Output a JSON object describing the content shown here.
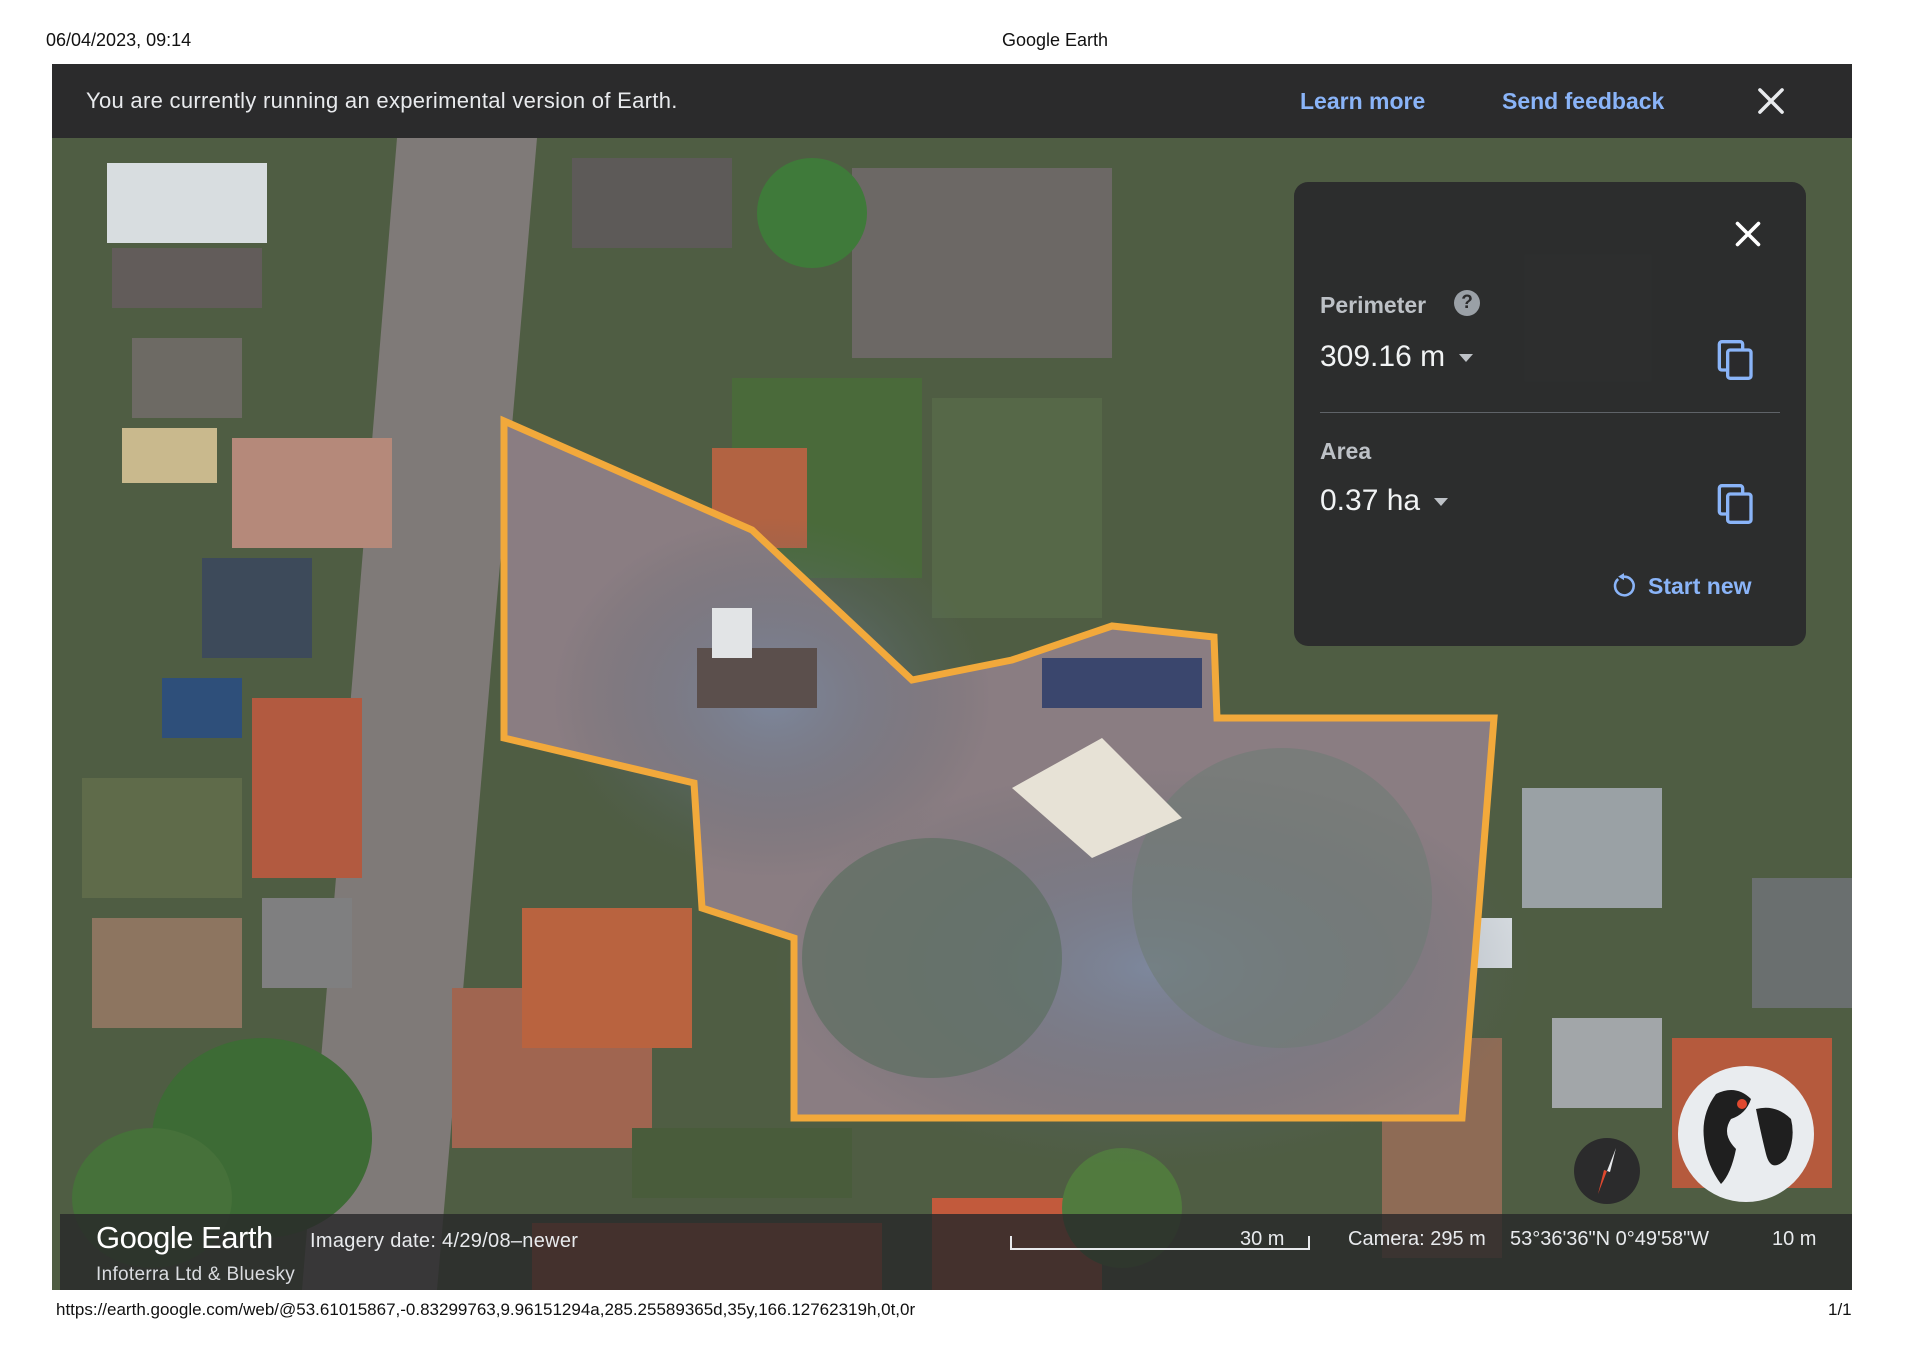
{
  "print": {
    "datetime": "06/04/2023, 09:14",
    "title": "Google Earth",
    "url": "https://earth.google.com/web/@53.61015867,-0.83299763,9.96151294a,285.25589365d,35y,166.12762319h,0t,0r",
    "page": "1/1"
  },
  "banner": {
    "message": "You are currently running an experimental version of Earth.",
    "learn_more": "Learn more",
    "send_feedback": "Send feedback",
    "close_icon": "close-icon"
  },
  "measure": {
    "perimeter_label": "Perimeter",
    "help_glyph": "?",
    "perimeter_value": "309.16 m",
    "area_label": "Area",
    "area_value": "0.37 ha",
    "start_new": "Start new",
    "icons": [
      "close-icon",
      "help-icon",
      "copy-icon",
      "dropdown-icon",
      "refresh-icon"
    ]
  },
  "bottom": {
    "brand_google": "Google",
    "brand_earth": "Earth",
    "imagery_date": "Imagery date: 4/29/08–newer",
    "attribution": "Infoterra Ltd & Bluesky",
    "scale": "30 m",
    "camera": "Camera: 295 m",
    "coords": "53°36'36\"N 0°49'58\"W",
    "elevation": "10 m"
  },
  "colors": {
    "polygon": "#f2a93b",
    "link": "#8ab4f8",
    "panel_bg": "#2a2a2c"
  }
}
